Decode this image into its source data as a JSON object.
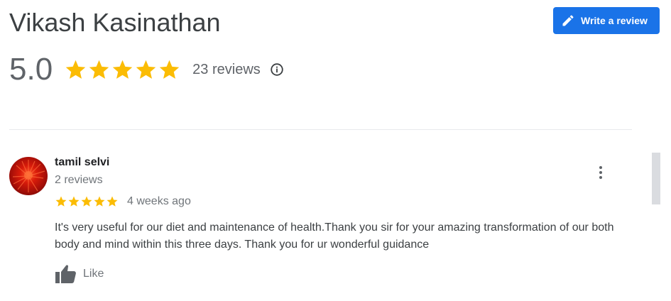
{
  "place": {
    "name": "Vikash Kasinathan"
  },
  "actions": {
    "write_review_label": "Write a review"
  },
  "summary": {
    "rating": "5.0",
    "stars": 5,
    "reviews_count_text": "23 reviews"
  },
  "review": {
    "author_name": "tamil selvi",
    "author_meta": "2 reviews",
    "stars": 5,
    "time_ago": "4 weeks ago",
    "text": "It's very useful for our diet and maintenance of health.Thank you sir for your amazing transformation of our both body and mind within this three days. Thank you for ur wonderful guidance",
    "like_label": "Like"
  },
  "icons": {
    "write": "pencil-icon",
    "info": "info-icon",
    "more": "more-vert-icon",
    "like": "thumb-up-icon",
    "star": "star-icon"
  },
  "colors": {
    "accent": "#1a73e8",
    "star": "#fbbc04",
    "text_primary": "#202124",
    "text_secondary": "#70757a"
  }
}
